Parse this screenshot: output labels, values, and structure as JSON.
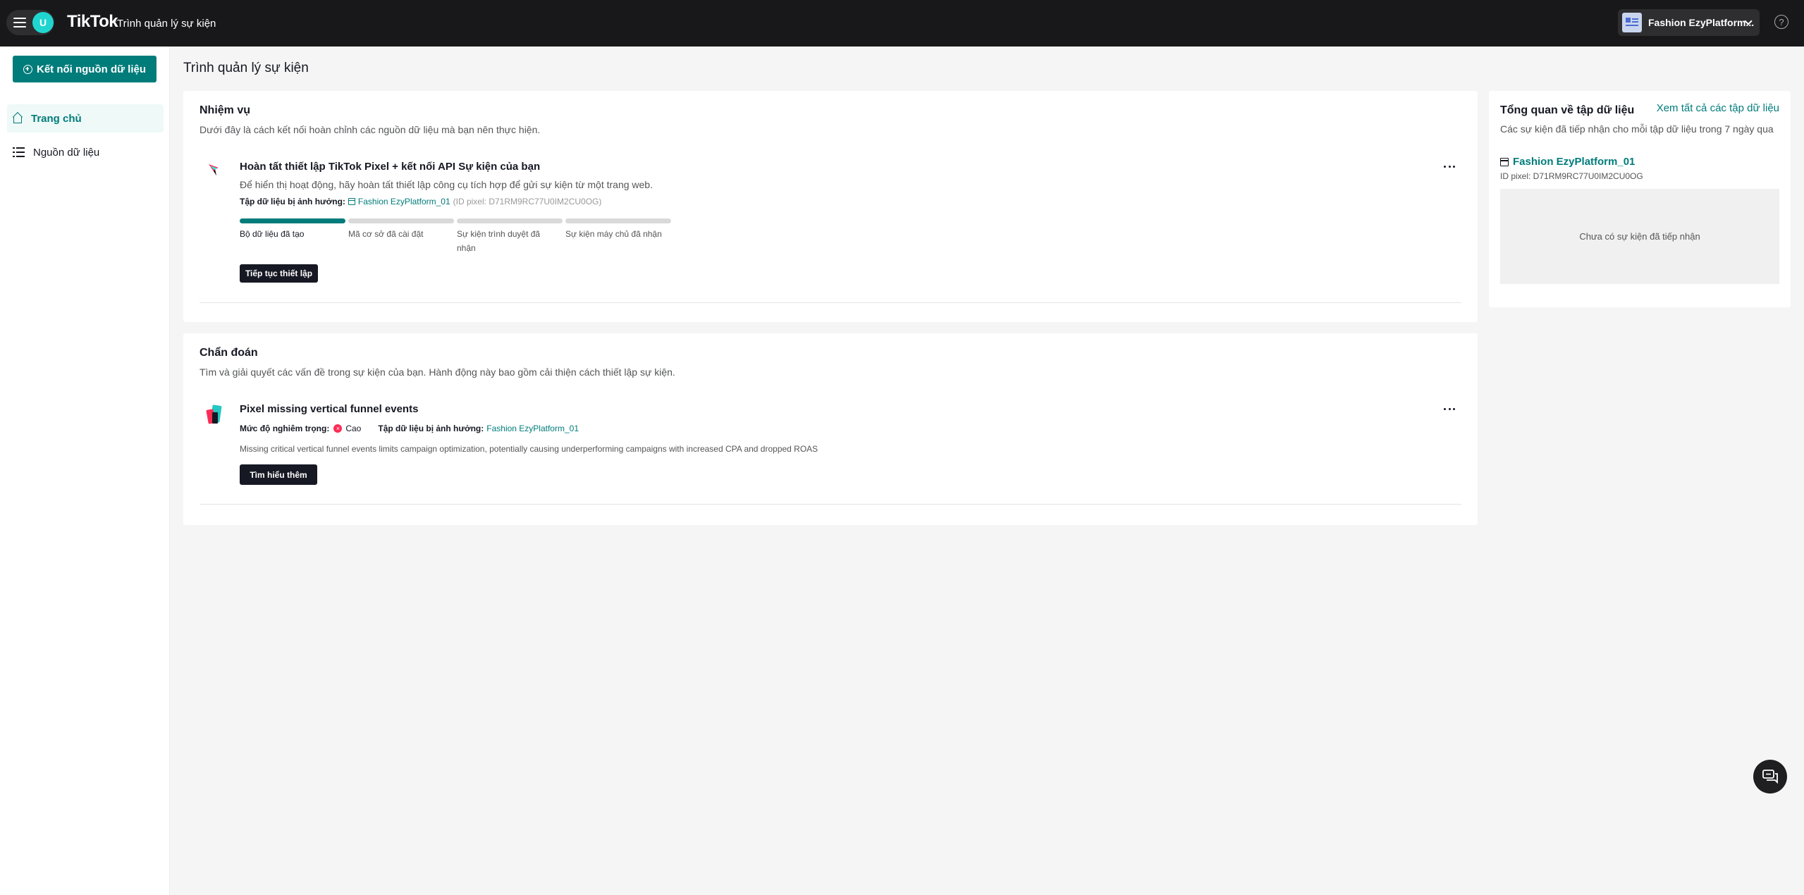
{
  "header": {
    "brand": "TikTok",
    "separator": ":",
    "subtitle": "Trình quản lý sự kiện",
    "user_initial": "U",
    "account_name": "Fashion EzyPlatform...",
    "help_symbol": "?"
  },
  "sidebar": {
    "connect_button": "Kết nối nguồn dữ liệu",
    "items": [
      {
        "label": "Trang chủ",
        "icon": "home-icon",
        "active": true
      },
      {
        "label": "Nguồn dữ liệu",
        "icon": "list-icon",
        "active": false
      }
    ]
  },
  "page": {
    "title": "Trình quản lý sự kiện"
  },
  "tasks": {
    "title": "Nhiệm vụ",
    "description": "Dưới đây là cách kết nối hoàn chỉnh các nguồn dữ liệu mà bạn nên thực hiện.",
    "item": {
      "title": "Hoàn tất thiết lập TikTok Pixel + kết nối API Sự kiện của bạn",
      "description": "Để hiển thị hoạt động, hãy hoàn tất thiết lập công cụ tích hợp để gửi sự kiện từ một trang web.",
      "affected_label": "Tập dữ liệu bị ảnh hưởng:",
      "dataset_name": "Fashion EzyPlatform_01",
      "pixel_id_text": "(ID pixel: D71RM9RC77U0IM2CU0OG)",
      "steps": [
        {
          "label": "Bộ dữ liệu đã tạo",
          "done": true
        },
        {
          "label": "Mã cơ sở đã cài đặt",
          "done": false
        },
        {
          "label": "Sự kiện trình duyệt đã nhận",
          "done": false
        },
        {
          "label": "Sự kiện máy chủ đã nhận",
          "done": false
        }
      ],
      "progress_completed": 1,
      "progress_total": 4,
      "button": "Tiếp tục thiết lập",
      "more": "..."
    }
  },
  "diagnostics": {
    "title": "Chẩn đoán",
    "description": "Tìm và giải quyết các vấn đề trong sự kiện của bạn. Hành động này bao gồm cải thiện cách thiết lập sự kiện.",
    "item": {
      "title": "Pixel missing vertical funnel events",
      "severity_label": "Mức độ nghiêm trọng:",
      "severity_value": "Cao",
      "severity_symbol": "×",
      "affected_label": "Tập dữ liệu bị ảnh hưởng:",
      "dataset_name": "Fashion EzyPlatform_01",
      "detail": "Missing critical vertical funnel events limits campaign optimization, potentially causing underperforming campaigns with increased CPA and dropped ROAS",
      "button": "Tìm hiểu thêm",
      "more": "..."
    }
  },
  "overview": {
    "title": "Tổng quan về tập dữ liệu",
    "view_all_link": "Xem tất cả các tập dữ liệu",
    "description": "Các sự kiện đã tiếp nhận cho mỗi tập dữ liệu trong 7 ngày qua",
    "dataset_name": "Fashion EzyPlatform_01",
    "pixel_id": "ID pixel: D71RM9RC77U0IM2CU0OG",
    "empty_message": "Chưa có sự kiện đã tiếp nhận"
  },
  "colors": {
    "accent": "#007c7a",
    "topbar": "#18181a",
    "severity_high": "#fe2c55"
  }
}
